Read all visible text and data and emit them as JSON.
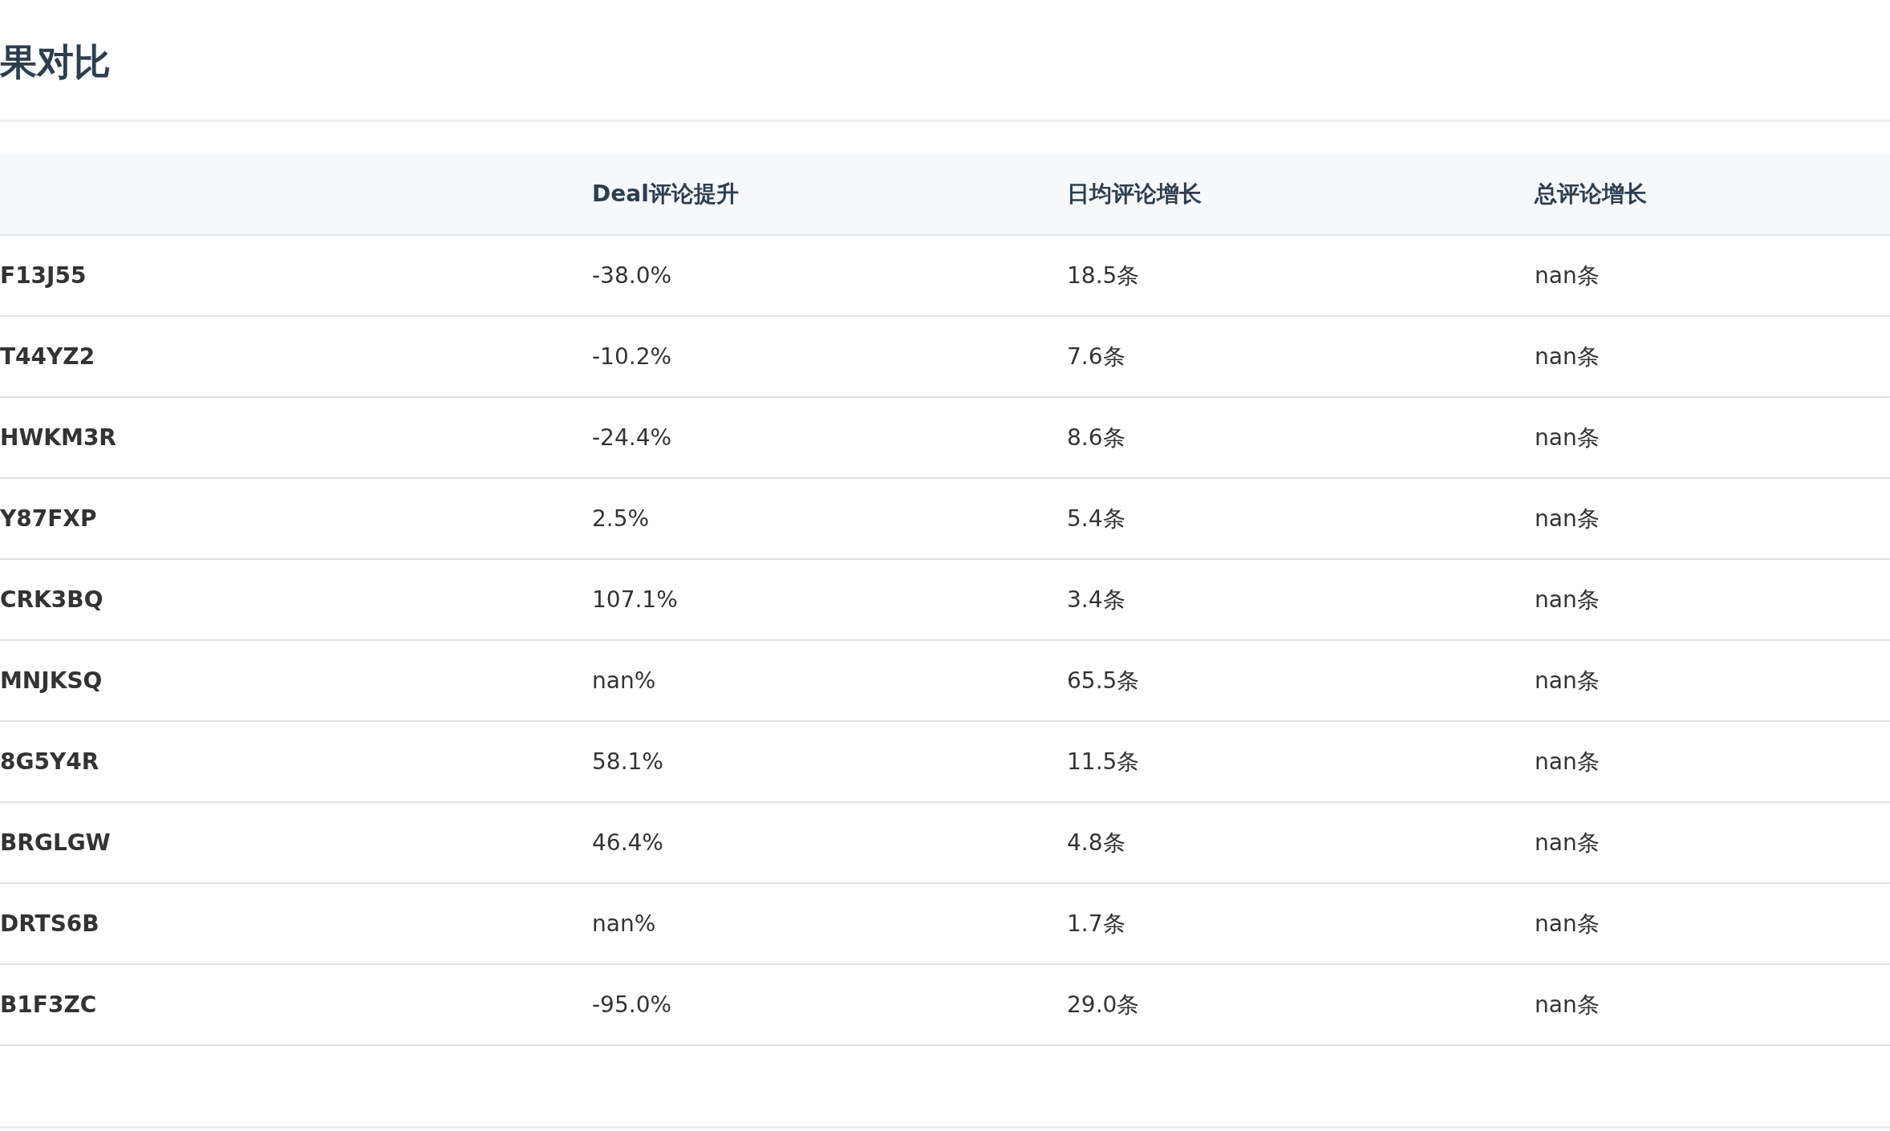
{
  "title": "果对比",
  "table": {
    "columns": [
      "",
      "Deal评论提升",
      "日均评论增长",
      "总评论增长"
    ],
    "rows": [
      [
        "F13J55",
        "-38.0%",
        "18.5条",
        "nan条"
      ],
      [
        "T44YZ2",
        "-10.2%",
        "7.6条",
        "nan条"
      ],
      [
        "HWKM3R",
        "-24.4%",
        "8.6条",
        "nan条"
      ],
      [
        "Y87FXP",
        "2.5%",
        "5.4条",
        "nan条"
      ],
      [
        "CRK3BQ",
        "107.1%",
        "3.4条",
        "nan条"
      ],
      [
        "MNJKSQ",
        "nan%",
        "65.5条",
        "nan条"
      ],
      [
        "8G5Y4R",
        "58.1%",
        "11.5条",
        "nan条"
      ],
      [
        "BRGLGW",
        "46.4%",
        "4.8条",
        "nan条"
      ],
      [
        "DRTS6B",
        "nan%",
        "1.7条",
        "nan条"
      ],
      [
        "B1F3ZC",
        "-95.0%",
        "29.0条",
        "nan条"
      ]
    ]
  }
}
